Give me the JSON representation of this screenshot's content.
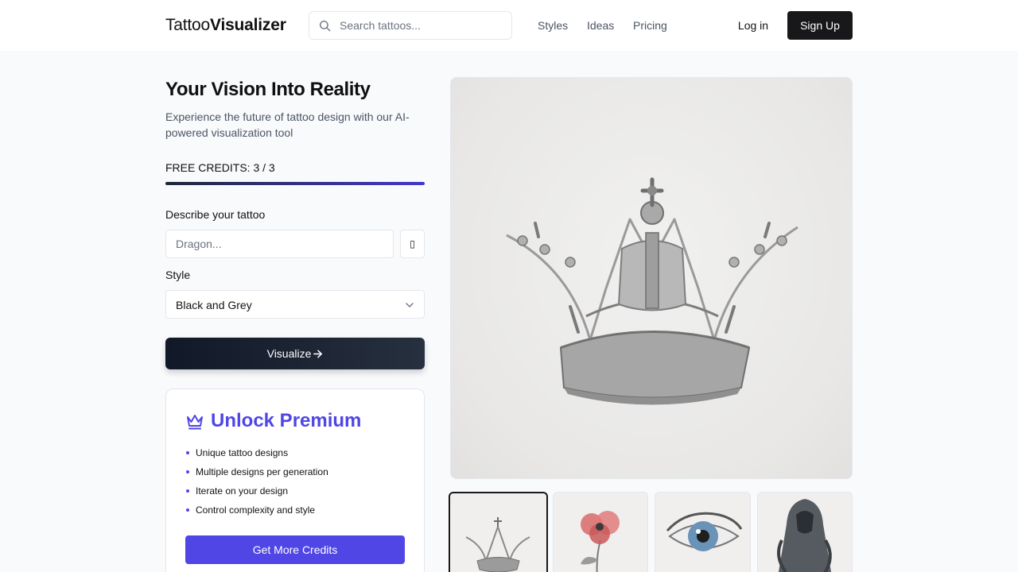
{
  "header": {
    "logo_light": "Tattoo",
    "logo_bold": "Visualizer",
    "search_placeholder": "Search tattoos...",
    "nav": [
      "Styles",
      "Ideas",
      "Pricing"
    ],
    "login": "Log in",
    "signup": "Sign Up"
  },
  "hero": {
    "title": "Your Vision Into Reality",
    "subtitle": "Experience the future of tattoo design with our AI-powered visualization tool"
  },
  "credits": {
    "label": "FREE CREDITS: 3 / 3",
    "fraction_remaining": 1.0
  },
  "form": {
    "describe_label": "Describe your tattoo",
    "describe_placeholder": "Dragon...",
    "describe_value": "",
    "icon_button": "▯",
    "style_label": "Style",
    "style_value": "Black and Grey",
    "submit": "Visualize"
  },
  "premium": {
    "title": "Unlock Premium",
    "features": [
      "Unique tattoo designs",
      "Multiple designs per generation",
      "Iterate on your design",
      "Control complexity and style"
    ],
    "button": "Get More Credits"
  },
  "gallery": {
    "main_image": "crown-tattoo",
    "thumbnails": [
      "crown-tattoo",
      "poppy-flower-tattoo",
      "eye-tattoo",
      "reaper-tattoo"
    ],
    "selected_index": 0
  },
  "colors": {
    "accent": "#4f46e5",
    "primary_dark": "#18181b"
  }
}
